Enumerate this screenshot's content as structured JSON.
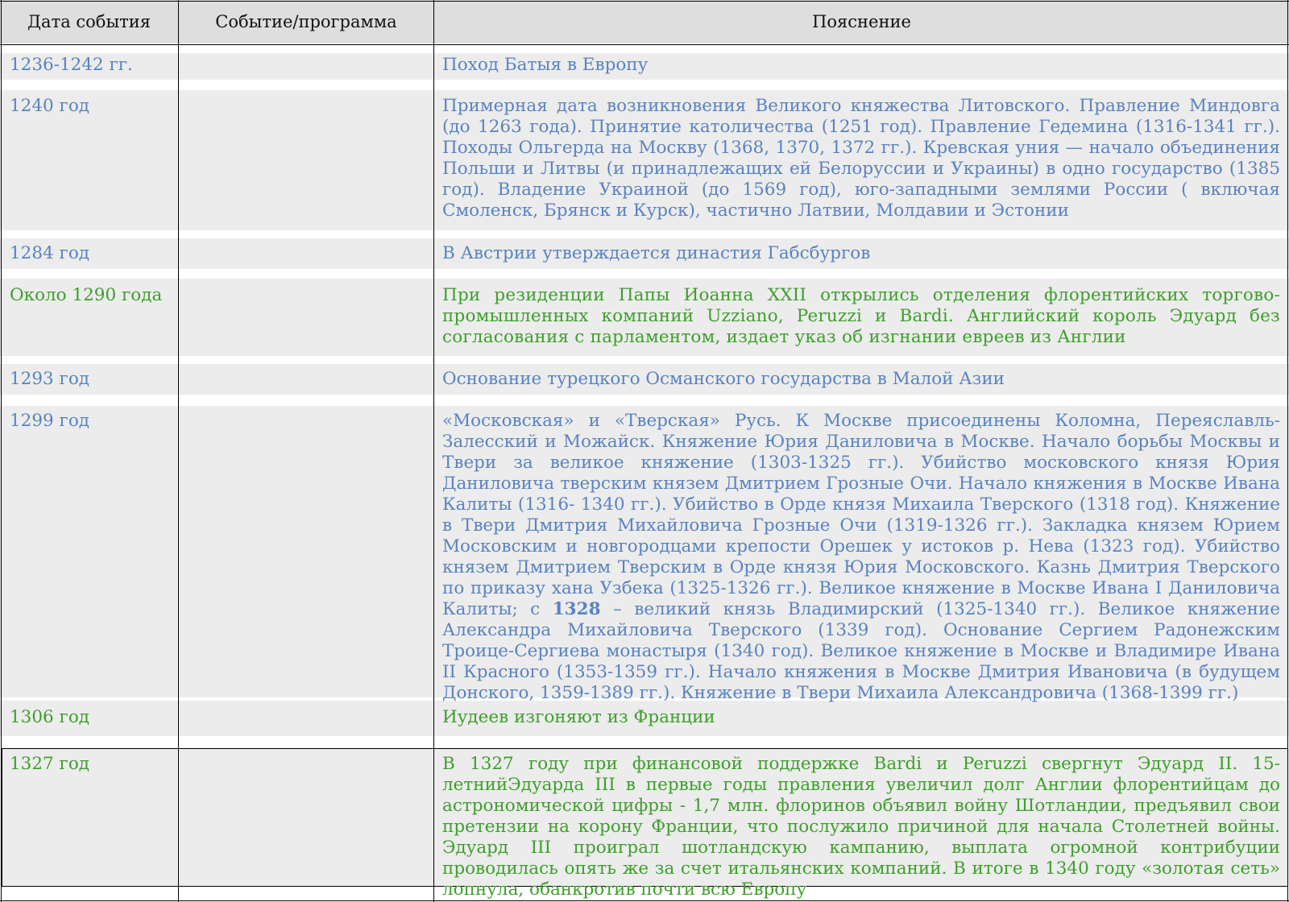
{
  "header": {
    "col_date": "Дата события",
    "col_event": "Событие/программа",
    "col_note": "Пояснение"
  },
  "colors": {
    "blue": "#5a83c0",
    "green": "#3f9e2c",
    "row_bg": "#ececec",
    "header_bg": "#dedede"
  },
  "rows": [
    {
      "date": "1236-1242 гг.",
      "event": "",
      "note": "Поход Батыя в  Европу",
      "color": "blue"
    },
    {
      "date": "1240 год",
      "event": "",
      "note": "Примерная дата возникновения Великого княжества Литовского. Правление Миндовга (до 1263 года). Принятие католичества (1251 год). Правление Гедемина (1316-1341 гг.).  Походы Ольгерда на Москву (1368, 1370, 1372 гг.). Кревская уния — начало объединения Польши и Литвы (и принадлежащих ей Белоруссии и Украины) в одно государство (1385 год). Владение Украиной (до 1569 год), юго-западными землями России ( включая Смоленск, Брянск и Курск), частично Латвии, Молдавии и Эстонии",
      "color": "blue"
    },
    {
      "date": "1284 год",
      "event": "",
      "note": "В Австрии утверждается династия Габсбургов",
      "color": "blue"
    },
    {
      "date": "Около 1290 года",
      "event": "",
      "note": "При резиденции Папы Иоанна XXII открылись отделения флорентийских торгово-промышленных компаний Uzziano, Peruzzi и Bardi. Английский король Эдуард без согласования с парламентом, издает указ об изгнании евреев из Англии",
      "color": "green"
    },
    {
      "date": "1293 год",
      "event": "",
      "note": "Основание турецкого Османского государства в Малой Азии",
      "color": "blue"
    },
    {
      "date": "1299 год",
      "event": "",
      "note_pre": "«Московская» и «Тверская» Русь. К Москве присоединены Коломна, Переяславль-Залесский и Можайск. Княжение Юрия Даниловича в Москве. Начало борьбы Москвы и Твери за великое княжение (1303-1325 гг.). Убийство московского князя Юрия Даниловича тверским князем Дмитрием Грозные Очи. Начало княжения в Москве Ивана Калиты (1316- 1340 гг.). Убийство в Орде князя Михаила Тверского (1318 год). Княжение в Твери Дмитрия Михайловича Грозные Очи (1319-1326 гг.). Закладка князем Юрием Московским и новгородцами крепости Орешек у истоков р. Нева (1323 год). Убийство князем Дмитрием Тверским в Орде князя Юрия Московского. Казнь Дмитрия Тверского по приказу хана Узбека (1325-1326 гг.). Великое княжение в Москве Ивана I Даниловича Калиты; с ",
      "note_bold": "1328",
      "note_post": " –  великий князь Владимирский (1325-1340 гг.). Великое княжение Александра Михайловича Тверского (1339 год). Основание Сергием Радонежским Троице-Сергиева монастыря (1340 год). Великое княжение в Москве и Владимире Ивана II Красного (1353-1359 гг.). Начало княжения в Москве Дмитрия Ивановича (в будущем Донского, 1359-1389 гг.). Княжение в Твери Михаила Александровича (1368-1399 гг.)",
      "color": "blue"
    },
    {
      "date": "1306 год",
      "event": "",
      "note": "Иудеев изгоняют из Франции",
      "color": "green"
    },
    {
      "date": "1327 год",
      "event": "",
      "note": "В 1327 году при финансовой поддержке Bardi и Peruzzi свергнут Эдуард II. 15-летнийЭдуарда III в первые годы правления увеличил долг Англии флорентийцам до астрономической цифры - 1,7 млн. флоринов объявил войну Шотландии, предъявил свои претензии на корону Франции, что послужило причиной для начала Столетней войны. Эдуард III проиграл шотландскую кампанию, выплата огромной контрибуции проводилась опять же за счет итальянских компаний. В итоге в 1340 году «золотая сеть» лопнула, обанкротив почти всю Европу",
      "color": "green"
    }
  ]
}
